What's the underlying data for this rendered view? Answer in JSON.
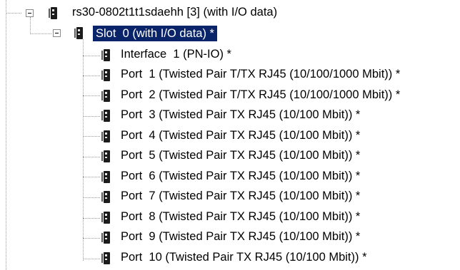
{
  "tree": {
    "root": {
      "label": "rs30-0802t1t1sdaehh [3] (with I/O data)",
      "icon": "device-icon",
      "expander": "minus"
    },
    "slot": {
      "label": "Slot  0 (with I/O data) *",
      "icon": "module-icon",
      "expander": "minus",
      "selected": true
    },
    "children": [
      {
        "label": "Interface  1 (PN-IO) *",
        "icon": "module-icon"
      },
      {
        "label": "Port  1 (Twisted Pair T/TX RJ45 (10/100/1000 Mbit)) *",
        "icon": "module-icon"
      },
      {
        "label": "Port  2 (Twisted Pair T/TX RJ45 (10/100/1000 Mbit)) *",
        "icon": "module-icon"
      },
      {
        "label": "Port  3 (Twisted Pair TX RJ45 (10/100 Mbit)) *",
        "icon": "module-icon"
      },
      {
        "label": "Port  4 (Twisted Pair TX RJ45 (10/100 Mbit)) *",
        "icon": "module-icon"
      },
      {
        "label": "Port  5 (Twisted Pair TX RJ45 (10/100 Mbit)) *",
        "icon": "module-icon"
      },
      {
        "label": "Port  6 (Twisted Pair TX RJ45 (10/100 Mbit)) *",
        "icon": "module-icon"
      },
      {
        "label": "Port  7 (Twisted Pair TX RJ45 (10/100 Mbit)) *",
        "icon": "module-icon"
      },
      {
        "label": "Port  8 (Twisted Pair TX RJ45 (10/100 Mbit)) *",
        "icon": "module-icon"
      },
      {
        "label": "Port  9 (Twisted Pair TX RJ45 (10/100 Mbit)) *",
        "icon": "module-icon"
      },
      {
        "label": "Port  10 (Twisted Pair TX RJ45 (10/100 Mbit)) *",
        "icon": "module-icon"
      }
    ]
  },
  "colors": {
    "selection": "#0a246a",
    "selection_text": "#ffffff",
    "tree_lines": "#9a9a9a"
  }
}
